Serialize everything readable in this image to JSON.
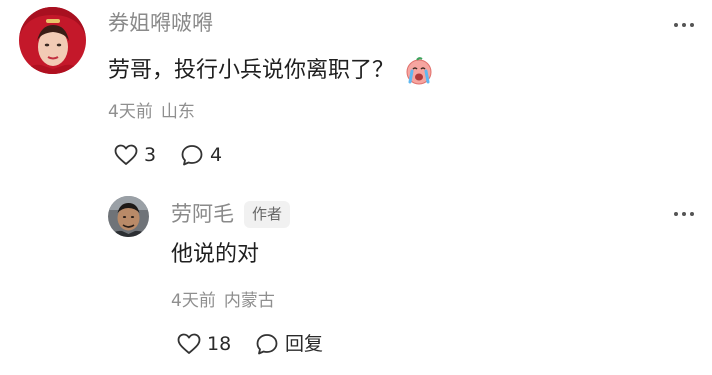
{
  "comment": {
    "username": "券姐嘚啵嘚",
    "text": "劳哥，投行小兵说你离职了？",
    "emoji_icon": "crying-baby-emoji-icon",
    "time": "4天前",
    "location": "山东",
    "likes": "3",
    "replies": "4",
    "avatar_icon": "woman-red-hood-avatar"
  },
  "reply": {
    "username": "劳阿毛",
    "badge": "作者",
    "text": "他说的对",
    "time": "4天前",
    "location": "内蒙古",
    "likes": "18",
    "reply_label": "回复",
    "avatar_icon": "man-avatar"
  },
  "colors": {
    "username": "#8a8a8a",
    "meta": "#8f8f8f",
    "text": "#1f1f1f",
    "badge_bg": "#f1f1f1"
  }
}
